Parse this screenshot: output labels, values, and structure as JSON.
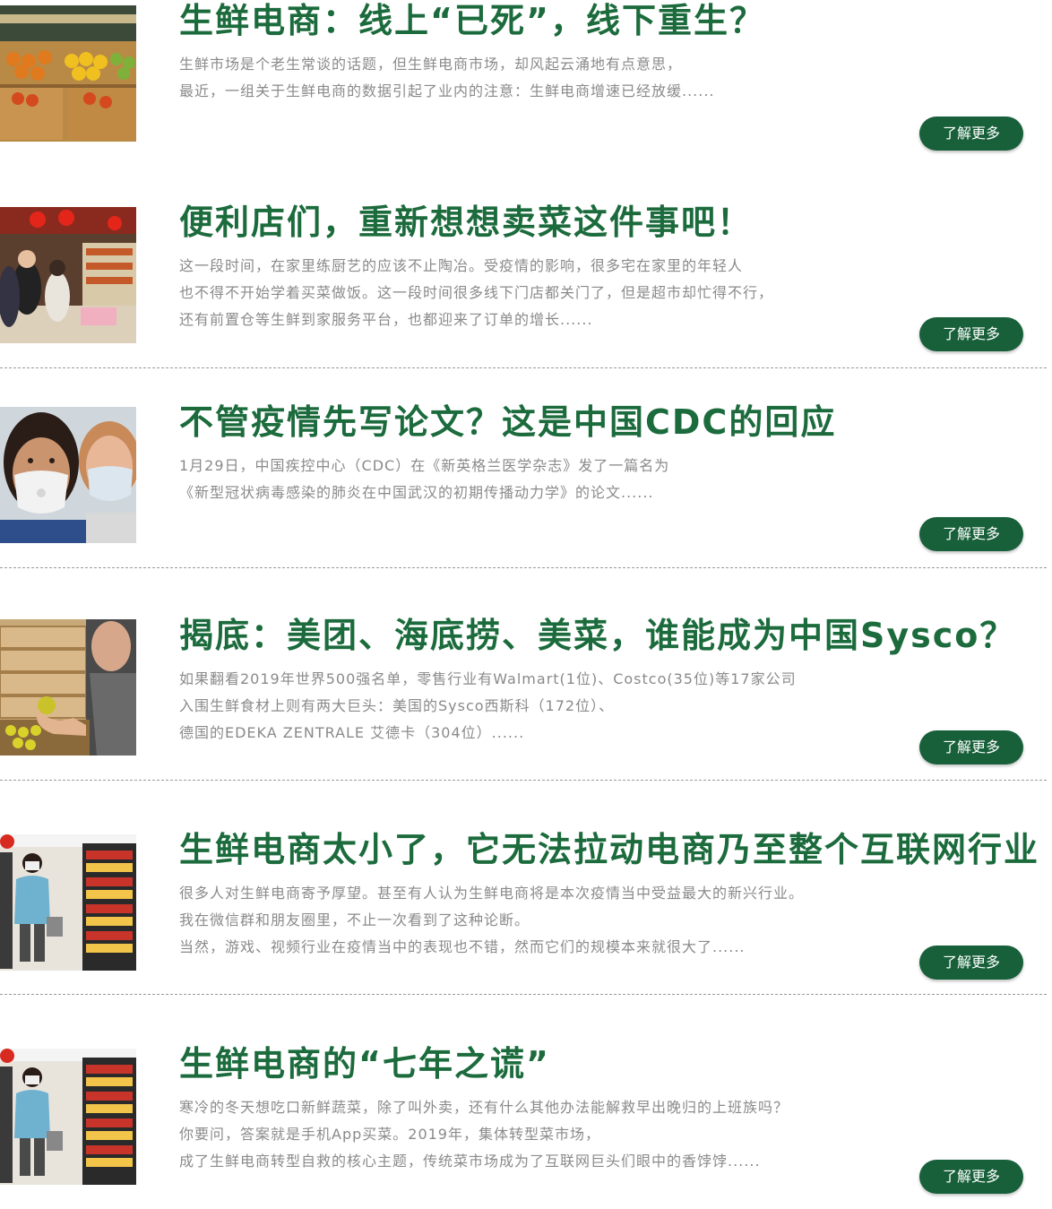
{
  "articles": [
    {
      "title": "生鲜电商：线上“已死”，线下重生？",
      "excerpt": [
        "生鲜市场是个老生常谈的话题，但生鲜电商市场，却风起云涌地有点意思，",
        "最近，一组关于生鲜电商的数据引起了业内的注意：生鲜电商增速已经放缓......"
      ],
      "button": "了解更多",
      "thumb_icon": "produce-shelves-photo"
    },
    {
      "title": "便利店们，重新想想卖菜这件事吧！",
      "excerpt": [
        "这一段时间，在家里练厨艺的应该不止陶冶。受疫情的影响，很多宅在家里的年轻人",
        "也不得不开始学着买菜做饭。这一段时间很多线下门店都关门了，但是超市却忙得不行，",
        "还有前置仓等生鲜到家服务平台，也都迎来了订单的增长......"
      ],
      "button": "了解更多",
      "thumb_icon": "convenience-store-photo"
    },
    {
      "title": "不管疫情先写论文？这是中国CDC的回应",
      "excerpt": [
        "1月29日，中国疾控中心（CDC）在《新英格兰医学杂志》发了一篇名为",
        "《新型冠状病毒感染的肺炎在中国武汉的初期传播动力学》的论文......"
      ],
      "button": "了解更多",
      "thumb_icon": "masked-women-photo"
    },
    {
      "title": "揭底：美团、海底捞、美菜，谁能成为中国Sysco？",
      "excerpt": [
        "如果翻看2019年世界500强名单，零售行业有Walmart(1位)、Costco(35位)等17家公司",
        "入围生鲜食材上则有两大巨头：美国的Sysco西斯科（172位）、",
        "德国的EDEKA ZENTRALE 艾德卡（304位）......"
      ],
      "button": "了解更多",
      "thumb_icon": "fruit-crates-photo"
    },
    {
      "title": "生鲜电商太小了，它无法拉动电商乃至整个互联网行业",
      "excerpt": [
        "很多人对生鲜电商寄予厚望。甚至有人认为生鲜电商将是本次疫情当中受益最大的新兴行业。",
        "我在微信群和朋友圈里，不止一次看到了这种论断。",
        "当然，游戏、视频行业在疫情当中的表现也不错，然而它们的规模本来就很大了......"
      ],
      "button": "了解更多",
      "thumb_icon": "supermarket-aisle-photo"
    },
    {
      "title": "生鲜电商的“七年之谎”",
      "excerpt": [
        "寒冷的冬天想吃口新鲜蔬菜，除了叫外卖，还有什么其他办法能解救早出晚归的上班族吗？",
        "你要问，答案就是手机App买菜。2019年，集体转型菜市场，",
        "成了生鲜电商转型自救的核心主题，传统菜市场成为了互联网巨头们眼中的香饽饽......"
      ],
      "button": "了解更多",
      "thumb_icon": "supermarket-aisle-photo"
    }
  ]
}
